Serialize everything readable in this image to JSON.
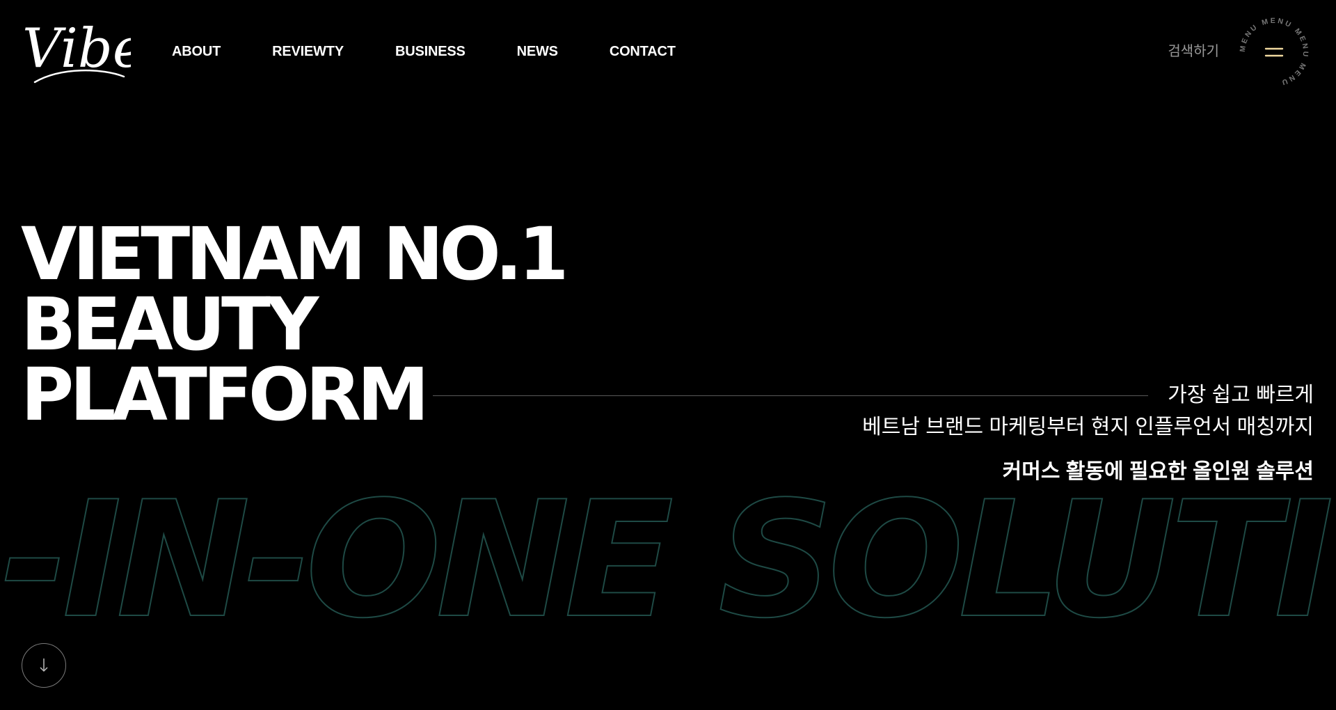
{
  "header": {
    "logo_text": "Vibey",
    "nav": [
      {
        "label": "ABOUT"
      },
      {
        "label": "REVIEWTY"
      },
      {
        "label": "BUSINESS"
      },
      {
        "label": "NEWS"
      },
      {
        "label": "CONTACT"
      }
    ],
    "search_label": "검색하기",
    "menu_ring_text": "MENU MENU MENU MENU",
    "menu_icon": "hamburger-icon"
  },
  "hero": {
    "title_lines": [
      "VIETNAM NO.1",
      "BEAUTY",
      "PLATFORM"
    ],
    "tagline": [
      "가장 쉽고 빠르게",
      "베트남 브랜드 마케팅부터 현지 인플루언서 매칭까지",
      "커머스 활동에 필요한 올인원 솔루션"
    ],
    "outline_text": "-IN-ONE SOLUTI",
    "scroll_icon": "arrow-down-icon"
  },
  "colors": {
    "background": "#000000",
    "text": "#ffffff",
    "muted": "#9a9a9a",
    "outline_accent": "#1e4a45",
    "menu_bars": "#f0d9a0"
  }
}
